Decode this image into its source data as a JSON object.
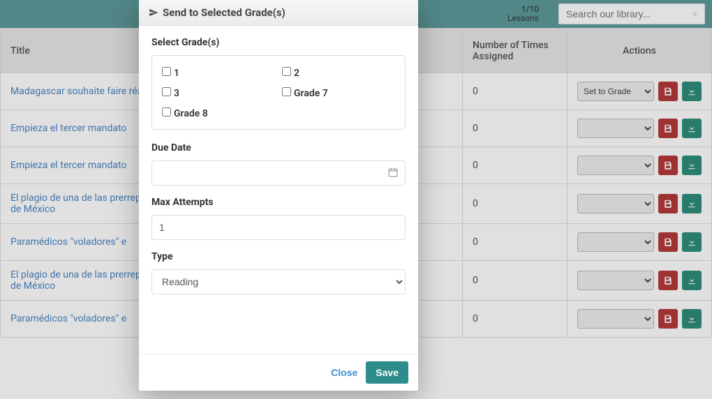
{
  "header": {
    "lessons_current": "1",
    "lessons_total": "10",
    "lessons_label": "Lessons",
    "search_placeholder": "Search our library..."
  },
  "table": {
    "columns": {
      "title": "Title",
      "times_assigned": "Number of Times Assigned",
      "actions": "Actions"
    },
    "action_option_default": "Set to Grade",
    "rows": [
      {
        "title": "Madagascar souhaite faire réalité",
        "times": "0",
        "action_selected": "Set to Grade"
      },
      {
        "title": "Empieza el tercer mandato",
        "times": "0",
        "action_selected": ""
      },
      {
        "title": "Empieza el tercer mandato",
        "times": "0",
        "action_selected": ""
      },
      {
        "title": "El plagio de una de las prerrepresentativas de México",
        "times": "0",
        "action_selected": ""
      },
      {
        "title": "Paramédicos \"voladores\" e",
        "times": "0",
        "action_selected": ""
      },
      {
        "title": "El plagio de una de las prerrepresentativas de México",
        "times": "0",
        "action_selected": ""
      },
      {
        "title": "Paramédicos \"voladores\" e",
        "times": "0",
        "action_selected": ""
      }
    ]
  },
  "modal": {
    "title": "Send to Selected Grade(s)",
    "select_grades_label": "Select Grade(s)",
    "grades": [
      "1",
      "2",
      "3",
      "Grade 7",
      "Grade 8"
    ],
    "due_date_label": "Due Date",
    "due_date_value": "",
    "max_attempts_label": "Max Attempts",
    "max_attempts_value": "1",
    "type_label": "Type",
    "type_value": "Reading",
    "close_label": "Close",
    "save_label": "Save"
  }
}
